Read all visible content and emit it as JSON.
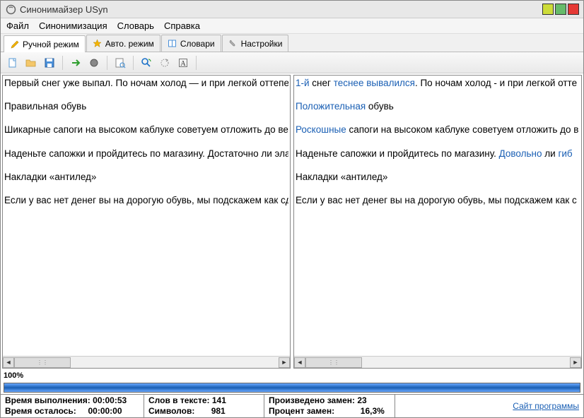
{
  "title": "Синонимайзер USyn",
  "menu": {
    "file": "Файл",
    "syn": "Синонимизация",
    "dict": "Словарь",
    "help": "Справка"
  },
  "tabs": {
    "manual": "Ручной режим",
    "auto": "Авто. режим",
    "dicts": "Словари",
    "settings": "Настройки"
  },
  "left": {
    "p1": "Первый снег уже выпал. По ночам холод — и при легкой оттепел",
    "p2": "Правильная обувь",
    "p3": "Шикарные сапоги на высоком каблуке советуем отложить до вес",
    "p4": "Наденьте сапожки и пройдитесь по магазину. Достаточно ли эла",
    "p5": "Накладки «антилед»",
    "p6": "Если у вас нет денег вы на дорогую обувь, мы подскажем как сде"
  },
  "right": {
    "p1a": "1-й",
    "p1b": " снег ",
    "p1c": "теснее вывалился",
    "p1d": ". По ночам холод - и при легкой отте",
    "p2a": "Положительная",
    "p2b": " обувь",
    "p3a": "Роскошные",
    "p3b": " сапоги на высоком каблуке советуем отложить до в",
    "p4a": "Наденьте сапожки и пройдитесь по магазину. ",
    "p4b": "Довольно",
    "p4c": " ли ",
    "p4d": "гиб",
    "p5": "Накладки «антилед»",
    "p6": "Если у вас нет денег вы на дорогую обувь, мы подскажем как с"
  },
  "progress_label": "100%",
  "status": {
    "exec_time_l": "Время выполнения:",
    "exec_time_v": "00:00:53",
    "remain_l": "Время осталось:",
    "remain_v": "00:00:00",
    "words_l": "Слов в тексте:",
    "words_v": "141",
    "chars_l": "Символов:",
    "chars_v": "981",
    "repl_l": "Произведено замен:",
    "repl_v": "23",
    "pct_l": "Процент замен:",
    "pct_v": "16,3%",
    "site": "Сайт программы"
  }
}
